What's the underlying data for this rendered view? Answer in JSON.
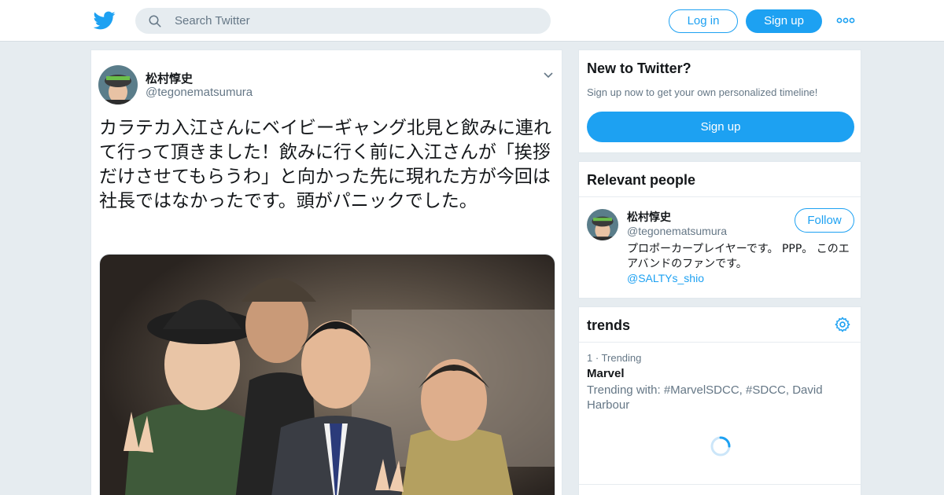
{
  "topbar": {
    "search_placeholder": "Search Twitter",
    "login_label": "Log in",
    "signup_label": "Sign up"
  },
  "tweet": {
    "author_name": "松村惇史",
    "author_handle": "@tegonematsumura",
    "text": "カラテカ入江さんにベイビーギャング北見と飲みに連れて行って頂きました！飲みに行く前に入江さんが「挨拶だけさせてもらうわ」と向かった先に現れた方が今回は社長ではなかったです。頭がパニックでした。"
  },
  "sidebar": {
    "new_to_twitter": {
      "title": "New to Twitter?",
      "subtitle": "Sign up now to get your own personalized timeline!",
      "signup_label": "Sign up"
    },
    "relevant_people": {
      "title": "Relevant people",
      "name": "松村惇史",
      "handle": "@tegonematsumura",
      "follow_label": "Follow",
      "bio": "プロポーカープレイヤーです。 PPP。 このエアバンドのファンです。",
      "bio_link": "@SALTYs_shio"
    },
    "trends": {
      "title": "trends",
      "items": [
        {
          "meta": "1 · Trending",
          "name": "Marvel",
          "with": "Trending with: #MarvelSDCC, #SDCC, David Harbour"
        }
      ]
    }
  },
  "colors": {
    "accent": "#1da1f2",
    "background": "#e6ecf0",
    "muted_text": "#657786"
  }
}
